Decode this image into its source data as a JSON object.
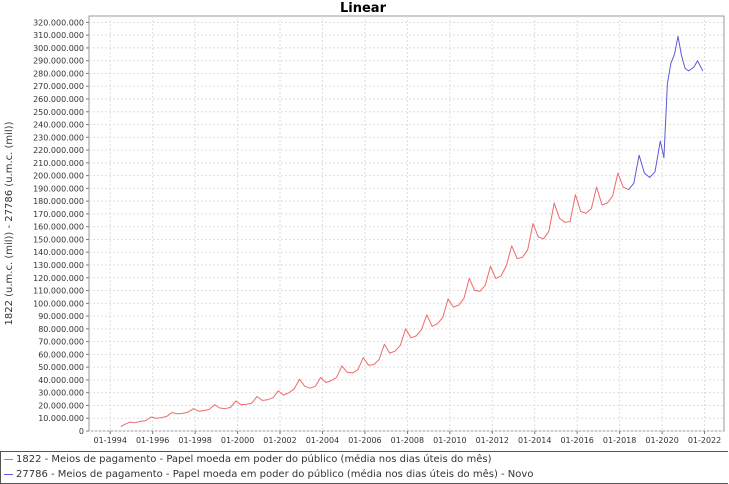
{
  "chart_data": {
    "type": "line",
    "title": "Linear",
    "xlabel": "",
    "ylabel": "1822 (u.m.c. (mil)) - 27786 (u.m.c. (mil))",
    "ylim": [
      0,
      325000000
    ],
    "xlim": [
      "1993-01",
      "2022-12"
    ],
    "grid": true,
    "x_ticks": [
      "01-1994",
      "01-1996",
      "01-1998",
      "01-2000",
      "01-2002",
      "01-2004",
      "01-2006",
      "01-2008",
      "01-2010",
      "01-2012",
      "01-2014",
      "01-2016",
      "01-2018",
      "01-2020",
      "01-2022"
    ],
    "y_ticks": [
      "0",
      "10.000.000",
      "20.000.000",
      "30.000.000",
      "40.000.000",
      "50.000.000",
      "60.000.000",
      "70.000.000",
      "80.000.000",
      "90.000.000",
      "100.000.000",
      "110.000.000",
      "120.000.000",
      "130.000.000",
      "140.000.000",
      "150.000.000",
      "160.000.000",
      "170.000.000",
      "180.000.000",
      "190.000.000",
      "200.000.000",
      "210.000.000",
      "220.000.000",
      "230.000.000",
      "240.000.000",
      "250.000.000",
      "260.000.000",
      "270.000.000",
      "280.000.000",
      "290.000.000",
      "300.000.000",
      "310.000.000",
      "320.000.000"
    ],
    "legend_position": "bottom",
    "series": [
      {
        "name": "1822 - Meios de pagamento - Papel moeda em poder do público (média nos dias úteis do mês)",
        "color": "#ef6a6a",
        "x": [
          "1994-07",
          "1994-09",
          "1994-12",
          "1995-03",
          "1995-06",
          "1995-09",
          "1995-12",
          "1996-03",
          "1996-06",
          "1996-09",
          "1996-12",
          "1997-03",
          "1997-06",
          "1997-09",
          "1997-12",
          "1998-03",
          "1998-06",
          "1998-09",
          "1998-12",
          "1999-03",
          "1999-06",
          "1999-09",
          "1999-12",
          "2000-03",
          "2000-06",
          "2000-09",
          "2000-12",
          "2001-03",
          "2001-06",
          "2001-09",
          "2001-12",
          "2002-03",
          "2002-06",
          "2002-09",
          "2002-12",
          "2003-03",
          "2003-06",
          "2003-09",
          "2003-12",
          "2004-03",
          "2004-06",
          "2004-09",
          "2004-12",
          "2005-03",
          "2005-06",
          "2005-09",
          "2005-12",
          "2006-03",
          "2006-06",
          "2006-09",
          "2006-12",
          "2007-03",
          "2007-06",
          "2007-09",
          "2007-12",
          "2008-03",
          "2008-06",
          "2008-09",
          "2008-12",
          "2009-03",
          "2009-06",
          "2009-09",
          "2009-12",
          "2010-03",
          "2010-06",
          "2010-09",
          "2010-12",
          "2011-03",
          "2011-06",
          "2011-09",
          "2011-12",
          "2012-03",
          "2012-06",
          "2012-09",
          "2012-12",
          "2013-03",
          "2013-06",
          "2013-09",
          "2013-12",
          "2014-03",
          "2014-06",
          "2014-09",
          "2014-12",
          "2015-03",
          "2015-06",
          "2015-09",
          "2015-12",
          "2016-03",
          "2016-06",
          "2016-09",
          "2016-12",
          "2017-03",
          "2017-06",
          "2017-09",
          "2017-12",
          "2018-03",
          "2018-06"
        ],
        "values": [
          3500000,
          5000000,
          7000000,
          6500000,
          7500000,
          8000000,
          11000000,
          10000000,
          10500000,
          11500000,
          14500000,
          13500000,
          13800000,
          14800000,
          17500000,
          15500000,
          16000000,
          17000000,
          20500000,
          18000000,
          17500000,
          18500000,
          23500000,
          20500000,
          21000000,
          21800000,
          27000000,
          24000000,
          24500000,
          26000000,
          31500000,
          28000000,
          30000000,
          33000000,
          40500000,
          35000000,
          33500000,
          35000000,
          42000000,
          38000000,
          39500000,
          42000000,
          51000000,
          46000000,
          45500000,
          48000000,
          57500000,
          51500000,
          52000000,
          56000000,
          68000000,
          61000000,
          62500000,
          67000000,
          80000000,
          73000000,
          74500000,
          79500000,
          91000000,
          82000000,
          84000000,
          89000000,
          103500000,
          97000000,
          98500000,
          104000000,
          119500000,
          110000000,
          109500000,
          114000000,
          129000000,
          119500000,
          121500000,
          129500000,
          145000000,
          135000000,
          136000000,
          142000000,
          162500000,
          152000000,
          150500000,
          156500000,
          178500000,
          166500000,
          163500000,
          164000000,
          185000000,
          172000000,
          170500000,
          174000000,
          191000000,
          177000000,
          178500000,
          184000000,
          202000000,
          191000000,
          189000000
        ]
      },
      {
        "name": "27786 - Meios de pagamento - Papel moeda em poder do público (média nos dias úteis do mês) - Novo",
        "color": "#5b5bd6",
        "x": [
          "2018-06",
          "2018-09",
          "2018-12",
          "2019-03",
          "2019-06",
          "2019-09",
          "2019-12",
          "2020-02",
          "2020-04",
          "2020-06",
          "2020-08",
          "2020-10",
          "2020-12",
          "2021-02",
          "2021-04",
          "2021-07",
          "2021-09",
          "2021-12"
        ],
        "values": [
          189000000,
          194000000,
          216000000,
          202000000,
          198500000,
          203000000,
          227000000,
          214000000,
          272000000,
          288000000,
          295000000,
          309000000,
          294000000,
          284000000,
          282000000,
          285000000,
          290000000,
          282000000
        ]
      }
    ]
  }
}
